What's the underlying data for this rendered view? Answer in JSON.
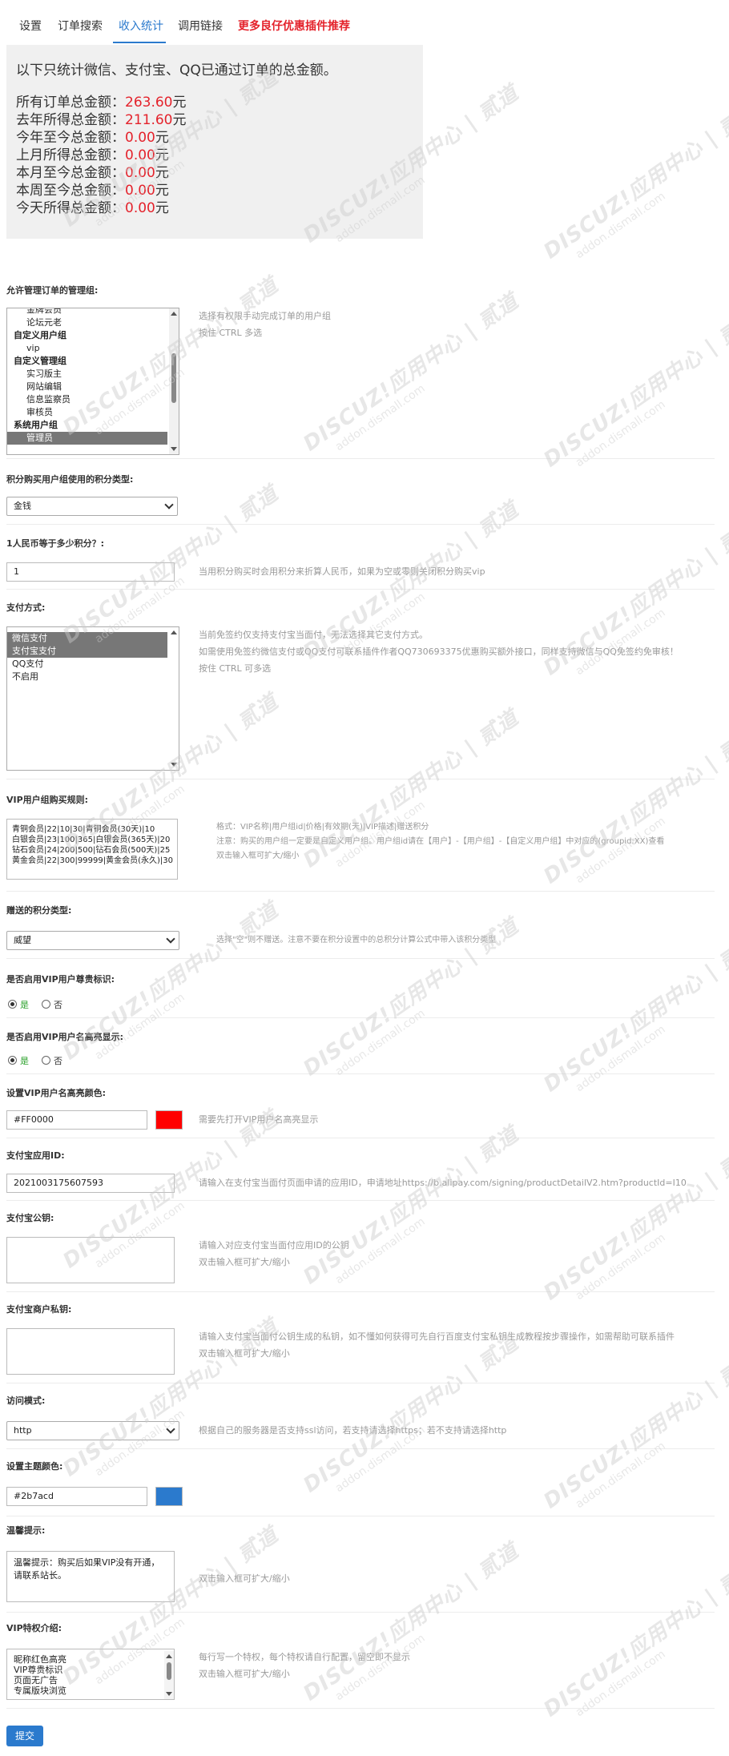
{
  "tabs": [
    {
      "label": "设置",
      "active": false
    },
    {
      "label": "订单搜索",
      "active": false
    },
    {
      "label": "收入统计",
      "active": true
    },
    {
      "label": "调用链接",
      "active": false
    },
    {
      "label": "更多良仔优惠插件推荐",
      "active": false
    }
  ],
  "stats": {
    "intro": "以下只统计微信、支付宝、QQ已通过订单的总金额。",
    "currency": "元",
    "rows": [
      {
        "label": "所有订单总金额：",
        "value": "263.60"
      },
      {
        "label": "去年所得总金额：",
        "value": "211.60"
      },
      {
        "label": "今年至今总金额：",
        "value": "0.00"
      },
      {
        "label": "上月所得总金额：",
        "value": "0.00"
      },
      {
        "label": "本月至今总金额：",
        "value": "0.00"
      },
      {
        "label": "本周至今总金额：",
        "value": "0.00"
      },
      {
        "label": "今天所得总金额：",
        "value": "0.00"
      }
    ]
  },
  "admin_groups": {
    "label": "允许管理订单的管理组:",
    "options": [
      {
        "text": "金牌会员",
        "kind": "sub",
        "selected": false
      },
      {
        "text": "论坛元老",
        "kind": "sub",
        "selected": false
      },
      {
        "text": "自定义用户组",
        "kind": "grp",
        "selected": false
      },
      {
        "text": "vip",
        "kind": "sub",
        "selected": false
      },
      {
        "text": "自定义管理组",
        "kind": "grp",
        "selected": false
      },
      {
        "text": "实习版主",
        "kind": "sub",
        "selected": false
      },
      {
        "text": "网站编辑",
        "kind": "sub",
        "selected": false
      },
      {
        "text": "信息监察员",
        "kind": "sub",
        "selected": false
      },
      {
        "text": "审核员",
        "kind": "sub",
        "selected": false
      },
      {
        "text": "系统用户组",
        "kind": "grp",
        "selected": false
      },
      {
        "text": "管理员",
        "kind": "sub",
        "selected": true
      }
    ],
    "hints": [
      "选择有权限手动完成订单的用户组",
      "按住 CTRL 多选"
    ]
  },
  "credit_type": {
    "label": "积分购买用户组使用的积分类型:",
    "value": "金钱"
  },
  "rmb_rate": {
    "label": "1人民币等于多少积分？:",
    "value": "1",
    "hint": "当用积分购买时会用积分来折算人民币，如果为空或零则关闭积分购买vip"
  },
  "payment": {
    "label": "支付方式:",
    "options": [
      {
        "text": "微信支付",
        "selected": true
      },
      {
        "text": "支付宝支付",
        "selected": true
      },
      {
        "text": "QQ支付",
        "selected": false
      },
      {
        "text": "不启用",
        "selected": false
      }
    ],
    "hints": [
      "当前免签约仅支持支付宝当面付，无法选择其它支付方式。",
      "如需使用免签约微信支付或QQ支付可联系插件作者QQ730693375优惠购买额外接口，同样支持微信与QQ免签约免审核！",
      "按住 CTRL 可多选"
    ]
  },
  "vip_rules": {
    "label": "VIP用户组购买规则:",
    "lines": [
      "青铜会员|22|10|30|青铜会员(30天)|10",
      "白银会员|23|100|365|白银会员(365天)|20",
      "钻石会员|24|200|500|钻石会员(500天)|25",
      "黄金会员|22|300|99999|黄金会员(永久)|30"
    ],
    "hints": [
      "格式：VIP名称|用户组id|价格|有效期(天)|VIP描述|赠送积分",
      "注意：购买的用户组一定要是自定义用户组。用户组id请在【用户】-【用户组】-【自定义用户组】中对应的(groupid:XX)查看",
      "双击输入框可扩大/缩小"
    ]
  },
  "gift_credit": {
    "label": "赠送的积分类型:",
    "value": "威望",
    "hint": "选择\"空\"则不赠送。注意不要在积分设置中的总积分计算公式中带入该积分类型"
  },
  "vip_badge": {
    "label": "是否启用VIP用户尊贵标识:",
    "yes": "是",
    "no": "否",
    "value": "yes"
  },
  "vip_highlight": {
    "label": "是否启用VIP用户名高亮显示:",
    "yes": "是",
    "no": "否",
    "value": "yes"
  },
  "highlight_color": {
    "label": "设置VIP用户名高亮颜色:",
    "value": "#FF0000",
    "swatch": "#ff0000",
    "hint": "需要先打开VIP用户名高亮显示"
  },
  "alipay_appid": {
    "label": "支付宝应用ID:",
    "value": "2021003175607593",
    "hint": "请输入在支付宝当面付页面申请的应用ID，申请地址https://b.alipay.com/signing/productDetailV2.htm?productId=I10"
  },
  "alipay_pubkey": {
    "label": "支付宝公钥:",
    "value": "",
    "hints": [
      "请输入对应支付宝当面付应用ID的公钥",
      "双击输入框可扩大/缩小"
    ]
  },
  "merchant_key": {
    "label": "支付宝商户私钥:",
    "value": "",
    "hints": [
      "请输入支付宝当面付公钥生成的私钥，如不懂如何获得可先自行百度支付宝私钥生成教程按步骤操作，如需帮助可联系插件",
      "双击输入框可扩大/缩小"
    ]
  },
  "access_mode": {
    "label": "访问模式:",
    "value": "http",
    "hint": "根据自己的服务器是否支持ssl访问，若支持请选择https；若不支持请选择http"
  },
  "theme_color": {
    "label": "设置主题颜色:",
    "value": "#2b7acd",
    "swatch": "#2b7acd"
  },
  "warm_tip": {
    "label": "温馨提示:",
    "value": "温馨提示：购买后如果VIP没有开通，请联系站长。",
    "hint": "双击输入框可扩大/缩小"
  },
  "vip_privileges": {
    "label": "VIP特权介绍:",
    "lines": [
      "昵称红色高亮",
      "VIP尊贵标识",
      "页面无广告",
      "专属版块浏览"
    ],
    "hints": [
      "每行写一个特权，每个特权请自行配置，留空即不显示",
      "双击输入框可扩大/缩小"
    ]
  },
  "submit_label": "提交",
  "watermark": {
    "brand": "DISCUZ!应用中心",
    "sub": "addon.dismall.com",
    "tag": "贰道"
  }
}
